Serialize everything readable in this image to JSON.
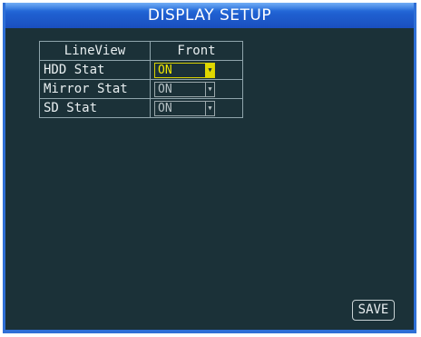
{
  "title": "DISPLAY SETUP",
  "table": {
    "header": [
      "LineView",
      "Front"
    ],
    "rows": [
      {
        "label": "HDD Stat",
        "value": "ON",
        "active": true
      },
      {
        "label": "Mirror Stat",
        "value": "ON",
        "active": false
      },
      {
        "label": "SD Stat",
        "value": "ON",
        "active": false
      }
    ]
  },
  "save_label": "SAVE",
  "colors": {
    "background": "#1b3138",
    "title_bar": "#1f5fd0",
    "active_value": "#f2e800"
  }
}
